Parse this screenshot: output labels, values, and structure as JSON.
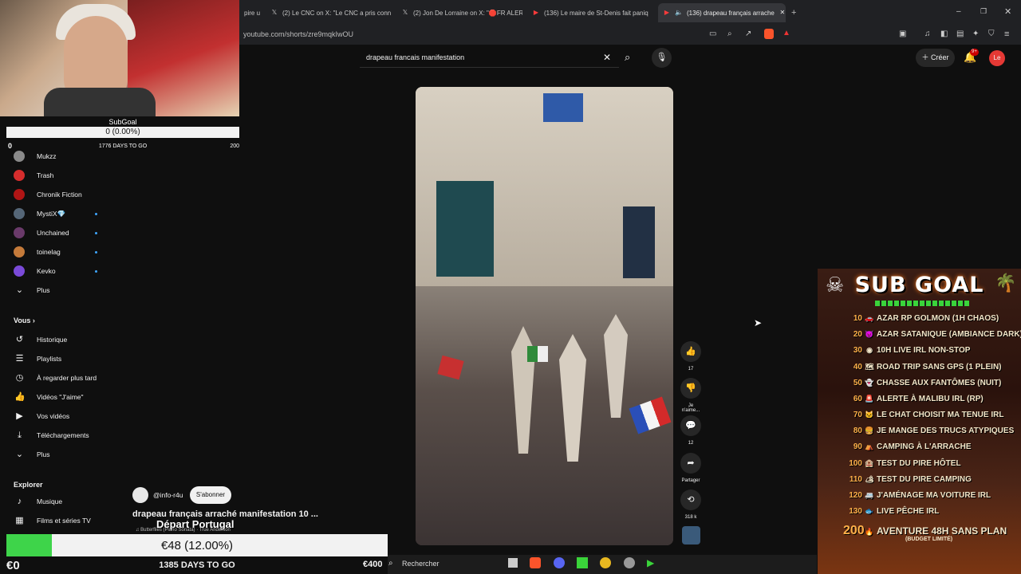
{
  "browser": {
    "tabs": [
      {
        "title": "pire u",
        "icon": "youtube-icon"
      },
      {
        "title": "(2) Le CNC on X: \"Le CNC a pris conn",
        "icon": "x-icon"
      },
      {
        "title": "(2) Jon De Lorraine on X: \"🛑FR ALER",
        "icon": "x-icon"
      },
      {
        "title": "(136) Le maire de St-Denis fait paniq",
        "icon": "youtube-icon"
      },
      {
        "title": "(136) drapeau français arrache",
        "icon": "youtube-icon",
        "active": true
      }
    ],
    "url": "youtube.com/shorts/zre9mqkIwOU"
  },
  "stream_overlay": {
    "subgoal_top": {
      "title": "SubGoal",
      "value": "0 (0.00%)",
      "min": "0",
      "days": "1776 DAYS TO GO",
      "max": "200"
    },
    "subgoal_bottom": {
      "value": "€48 (12.00%)",
      "min": "€0",
      "days": "1385 DAYS TO GO",
      "max": "€400",
      "progress": 0.12
    },
    "sub_goal_panel": {
      "title": "SUB GOAL",
      "goals": [
        {
          "n": "10",
          "text": "AZAR RP GOLMON (1H CHAOS)"
        },
        {
          "n": "20",
          "text": "AZAR SATANIQUE (AMBIANCE DARK)"
        },
        {
          "n": "30",
          "text": "10H LIVE IRL NON-STOP"
        },
        {
          "n": "40",
          "text": "ROAD TRIP SANS GPS (1 PLEIN)"
        },
        {
          "n": "50",
          "text": "CHASSE AUX FANTÔMES (NUIT)"
        },
        {
          "n": "60",
          "text": "ALERTE À MALIBU IRL (RP)"
        },
        {
          "n": "70",
          "text": "LE CHAT CHOISIT MA TENUE IRL"
        },
        {
          "n": "80",
          "text": "JE MANGE DES TRUCS ATYPIQUES"
        },
        {
          "n": "90",
          "text": "CAMPING À L'ARRACHE"
        },
        {
          "n": "100",
          "text": "TEST DU PIRE HÔTEL"
        },
        {
          "n": "110",
          "text": "TEST DU PIRE CAMPING"
        },
        {
          "n": "120",
          "text": "J'AMÉNAGE MA VOITURE IRL"
        },
        {
          "n": "130",
          "text": "LIVE PÊCHE IRL"
        },
        {
          "n": "200",
          "text": "AVENTURE 48H SANS PLAN",
          "sub": "(BUDGET LIMITÉ)"
        }
      ]
    }
  },
  "youtube": {
    "search_query": "drapeau francais manifestation",
    "create_label": "Créer",
    "notif_badge": "9+",
    "avatar_letter": "Le",
    "subscriptions": [
      {
        "name": "Mukzz",
        "color": "#8a8a8a",
        "dot": false
      },
      {
        "name": "Trash",
        "color": "#d62d2d",
        "dot": false
      },
      {
        "name": "Chronik Fiction",
        "color": "#b01515",
        "dot": false
      },
      {
        "name": "MystiX💎",
        "color": "#556677",
        "dot": true
      },
      {
        "name": "Unchained",
        "color": "#6a3a6a",
        "dot": true
      },
      {
        "name": "toinelag",
        "color": "#c47a3a",
        "dot": true
      },
      {
        "name": "Kevko",
        "color": "#7a4ad8",
        "dot": true
      },
      {
        "name": "Plus",
        "icon": "chevron-down-icon"
      }
    ],
    "you_header": "Vous",
    "you_items": [
      {
        "name": "Historique",
        "icon": "history-icon",
        "glyph": "↺"
      },
      {
        "name": "Playlists",
        "icon": "playlist-icon",
        "glyph": "☰"
      },
      {
        "name": "À regarder plus tard",
        "icon": "clock-icon",
        "glyph": "◷"
      },
      {
        "name": "Vidéos \"J'aime\"",
        "icon": "thumbs-up-icon",
        "glyph": "👍"
      },
      {
        "name": "Vos vidéos",
        "icon": "video-icon",
        "glyph": "▶"
      },
      {
        "name": "Téléchargements",
        "icon": "download-icon",
        "glyph": "⤓"
      },
      {
        "name": "Plus",
        "icon": "chevron-down-icon",
        "glyph": "⌄"
      }
    ],
    "explore_header": "Explorer",
    "explore_items": [
      {
        "name": "Musique",
        "icon": "music-icon",
        "glyph": "♪"
      },
      {
        "name": "Films et séries TV",
        "icon": "film-icon",
        "glyph": "🎬"
      }
    ],
    "short": {
      "channel": "@info-r4u",
      "subscribe_label": "S'abonner",
      "title": "drapeau français arraché manifestation 10 ...",
      "overlay_text": "Départ Portugal",
      "music": "♫ Butterflies (Piano Sonata) · True Anderson",
      "likes": "17",
      "dislike_label": "Je n'aime...",
      "comments": "12",
      "share_label": "Partager",
      "remix": "318 k"
    }
  },
  "taskbar": {
    "search_label": "Rechercher"
  }
}
